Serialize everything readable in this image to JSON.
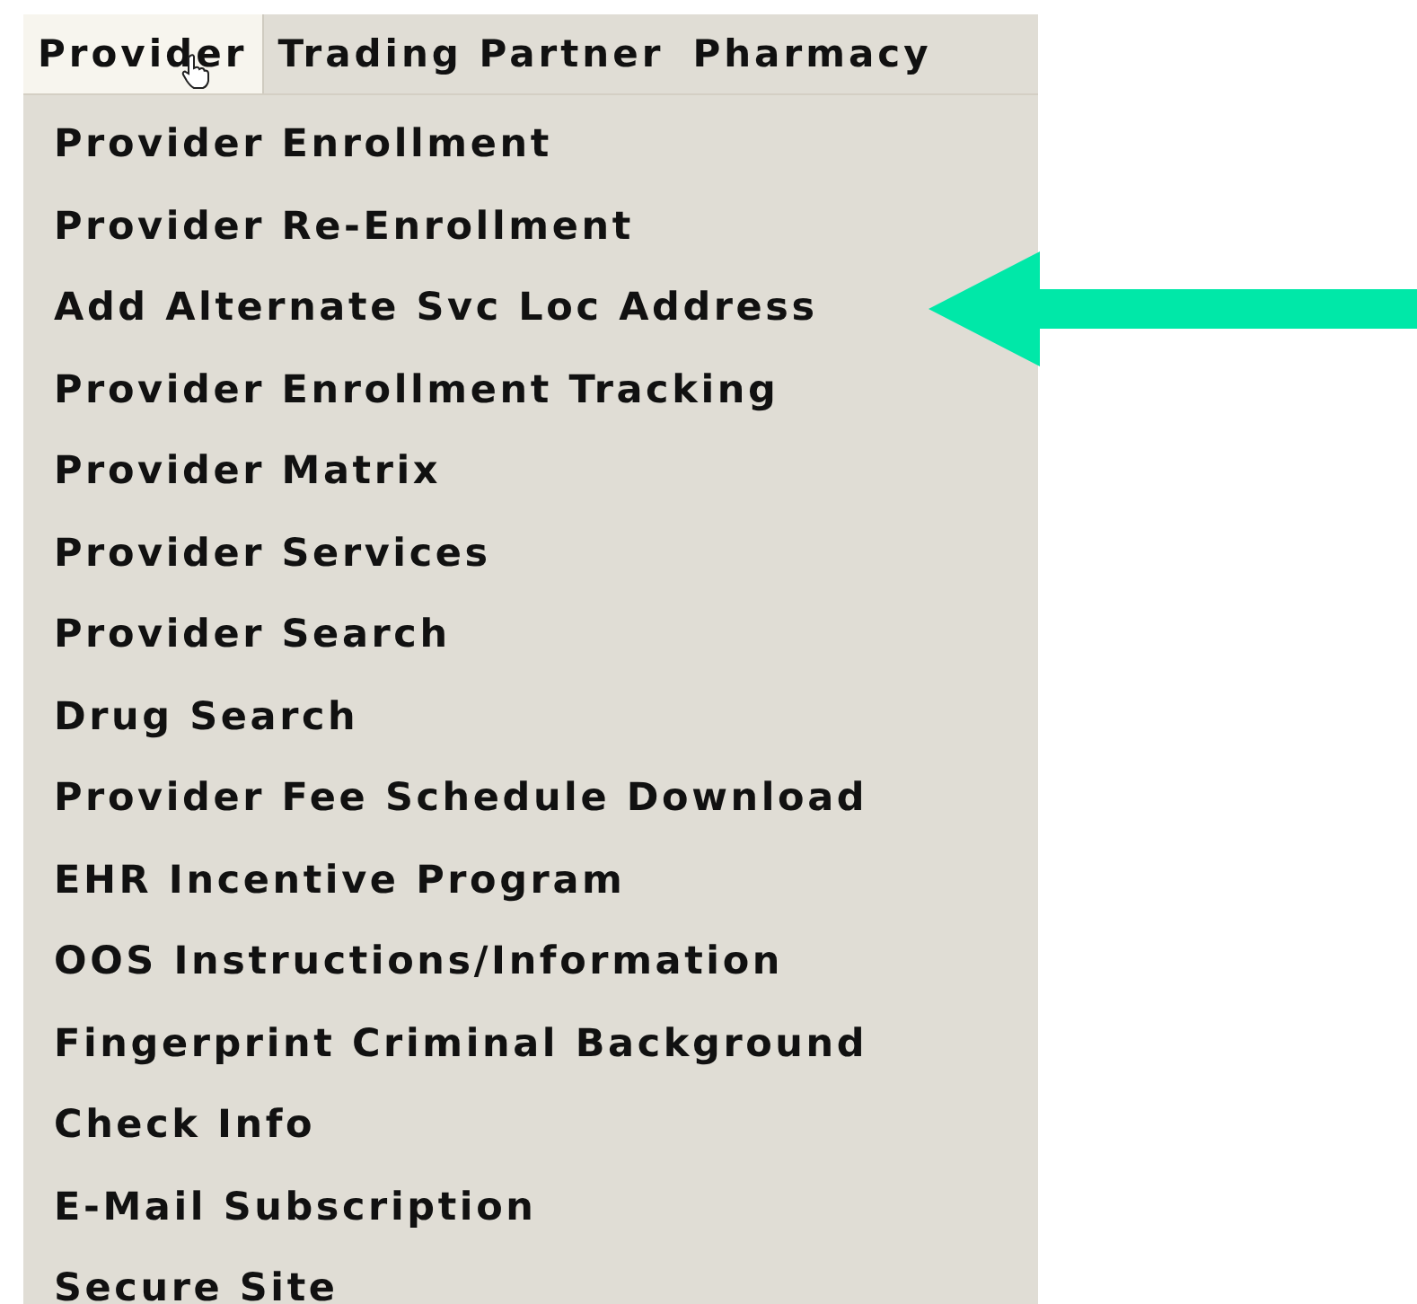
{
  "menu_bar": {
    "tabs": [
      {
        "label": "Provider",
        "selected": true
      },
      {
        "label": "Trading Partner",
        "selected": false
      },
      {
        "label": "Pharmacy",
        "selected": false
      }
    ]
  },
  "dropdown": {
    "items": [
      {
        "label": "Provider Enrollment",
        "annotated": false
      },
      {
        "label": "Provider Re-Enrollment",
        "annotated": false
      },
      {
        "label": "Add Alternate Svc Loc Address",
        "annotated": true
      },
      {
        "label": "Provider Enrollment Tracking",
        "annotated": false
      },
      {
        "label": "Provider Matrix",
        "annotated": false
      },
      {
        "label": "Provider Services",
        "annotated": false
      },
      {
        "label": "Provider Search",
        "annotated": false
      },
      {
        "label": "Drug Search",
        "annotated": false
      },
      {
        "label": "Provider Fee Schedule Download",
        "annotated": false
      },
      {
        "label": "EHR Incentive Program",
        "annotated": false
      },
      {
        "label": "OOS Instructions/Information",
        "annotated": false
      },
      {
        "label": "Fingerprint Criminal Background",
        "annotated": false
      },
      {
        "label": "Check Info",
        "annotated": false
      },
      {
        "label": "E-Mail Subscription",
        "annotated": false
      },
      {
        "label": "Secure Site",
        "annotated": false
      }
    ]
  }
}
